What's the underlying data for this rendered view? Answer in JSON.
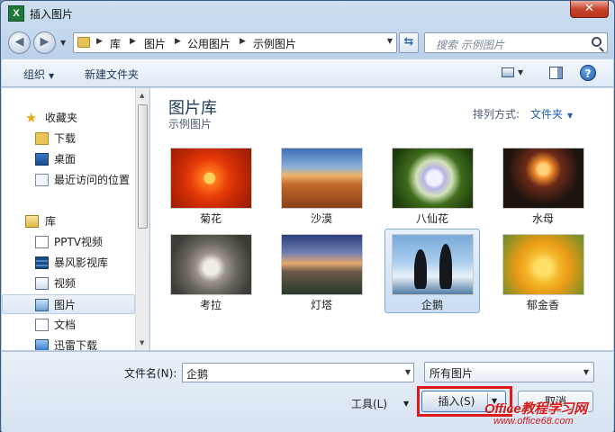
{
  "window": {
    "title": "插入图片",
    "app_icon": "X",
    "close": "✕"
  },
  "address": {
    "crumbs": [
      "库",
      "图片",
      "公用图片",
      "示例图片"
    ],
    "search_placeholder": "搜索 示例图片"
  },
  "toolbar": {
    "organize": "组织",
    "new_folder": "新建文件夹"
  },
  "nav": {
    "favorites": "收藏夹",
    "downloads": "下载",
    "desktop": "桌面",
    "recent": "最近访问的位置",
    "libraries": "库",
    "pptv": "PPTV视频",
    "baofeng": "暴风影视库",
    "videos": "视频",
    "pictures": "图片",
    "documents": "文档",
    "xunlei": "迅雷下载"
  },
  "content": {
    "library_title": "图片库",
    "library_subtitle": "示例图片",
    "arrange_label": "排列方式:",
    "arrange_value": "文件夹",
    "files": [
      {
        "name": "菊花"
      },
      {
        "name": "沙漠"
      },
      {
        "name": "八仙花"
      },
      {
        "name": "水母"
      },
      {
        "name": "考拉"
      },
      {
        "name": "灯塔"
      },
      {
        "name": "企鹅"
      },
      {
        "name": "郁金香"
      }
    ],
    "selected_file": "企鹅"
  },
  "footer": {
    "filename_label": "文件名(N):",
    "filename_value": "企鹅",
    "filetype_value": "所有图片",
    "tools_label": "工具(L)",
    "insert_label": "插入(S)",
    "cancel_label": "取消"
  },
  "watermark": {
    "brand": "Office教程学习网",
    "url": "www.office68.com"
  },
  "colors": {
    "highlight": "#e01818",
    "accent": "#1f5fb0"
  }
}
